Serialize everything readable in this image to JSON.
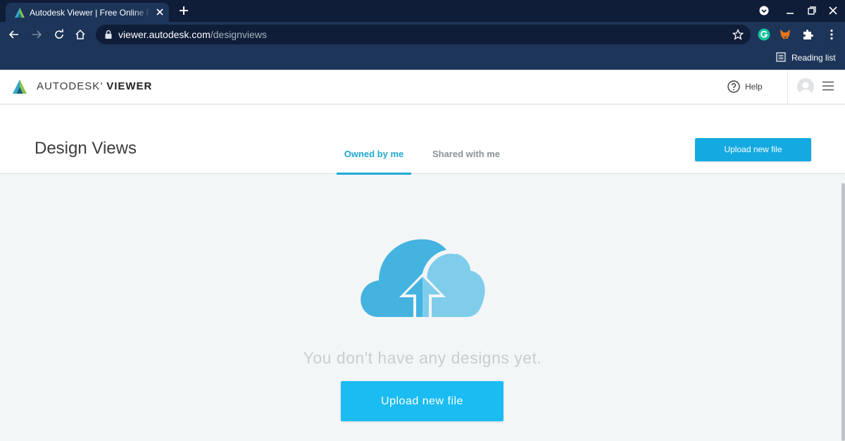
{
  "browser": {
    "tab_title": "Autodesk Viewer | Free Online File Viewer",
    "url_host": "viewer.autodesk.com",
    "url_path": "/designviews",
    "reading_list_label": "Reading list",
    "extension_icons": [
      "grammarly-icon",
      "metamask-fox-icon",
      "puzzle-extensions-icon"
    ]
  },
  "app": {
    "brand_light": "AUTODESK",
    "brand_bold": "VIEWER",
    "help_label": "Help"
  },
  "page": {
    "title": "Design Views",
    "tabs": [
      {
        "label": "Owned by me",
        "active": true
      },
      {
        "label": "Shared with me",
        "active": false
      }
    ],
    "upload_button_top": "Upload new file"
  },
  "empty_state": {
    "icon": "cloud-upload-icon",
    "message": "You don't have any designs yet.",
    "upload_button": "Upload new file"
  },
  "colors": {
    "accent": "#1fa8d2",
    "button_primary": "#14a9e0",
    "button_large": "#1bbcf1",
    "cloud_dark": "#44b3e0",
    "cloud_light": "#7fcdeb",
    "chrome_dark": "#0f1d38",
    "chrome_toolbar": "#1d3559"
  }
}
